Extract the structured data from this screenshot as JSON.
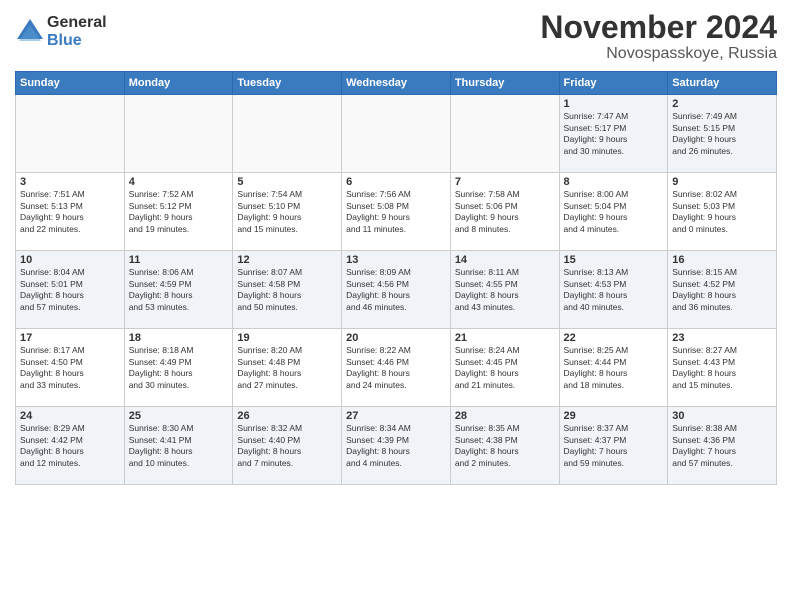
{
  "logo": {
    "general": "General",
    "blue": "Blue"
  },
  "title": "November 2024",
  "location": "Novospasskoye, Russia",
  "days_of_week": [
    "Sunday",
    "Monday",
    "Tuesday",
    "Wednesday",
    "Thursday",
    "Friday",
    "Saturday"
  ],
  "weeks": [
    [
      {
        "day": "",
        "info": ""
      },
      {
        "day": "",
        "info": ""
      },
      {
        "day": "",
        "info": ""
      },
      {
        "day": "",
        "info": ""
      },
      {
        "day": "",
        "info": ""
      },
      {
        "day": "1",
        "info": "Sunrise: 7:47 AM\nSunset: 5:17 PM\nDaylight: 9 hours\nand 30 minutes."
      },
      {
        "day": "2",
        "info": "Sunrise: 7:49 AM\nSunset: 5:15 PM\nDaylight: 9 hours\nand 26 minutes."
      }
    ],
    [
      {
        "day": "3",
        "info": "Sunrise: 7:51 AM\nSunset: 5:13 PM\nDaylight: 9 hours\nand 22 minutes."
      },
      {
        "day": "4",
        "info": "Sunrise: 7:52 AM\nSunset: 5:12 PM\nDaylight: 9 hours\nand 19 minutes."
      },
      {
        "day": "5",
        "info": "Sunrise: 7:54 AM\nSunset: 5:10 PM\nDaylight: 9 hours\nand 15 minutes."
      },
      {
        "day": "6",
        "info": "Sunrise: 7:56 AM\nSunset: 5:08 PM\nDaylight: 9 hours\nand 11 minutes."
      },
      {
        "day": "7",
        "info": "Sunrise: 7:58 AM\nSunset: 5:06 PM\nDaylight: 9 hours\nand 8 minutes."
      },
      {
        "day": "8",
        "info": "Sunrise: 8:00 AM\nSunset: 5:04 PM\nDaylight: 9 hours\nand 4 minutes."
      },
      {
        "day": "9",
        "info": "Sunrise: 8:02 AM\nSunset: 5:03 PM\nDaylight: 9 hours\nand 0 minutes."
      }
    ],
    [
      {
        "day": "10",
        "info": "Sunrise: 8:04 AM\nSunset: 5:01 PM\nDaylight: 8 hours\nand 57 minutes."
      },
      {
        "day": "11",
        "info": "Sunrise: 8:06 AM\nSunset: 4:59 PM\nDaylight: 8 hours\nand 53 minutes."
      },
      {
        "day": "12",
        "info": "Sunrise: 8:07 AM\nSunset: 4:58 PM\nDaylight: 8 hours\nand 50 minutes."
      },
      {
        "day": "13",
        "info": "Sunrise: 8:09 AM\nSunset: 4:56 PM\nDaylight: 8 hours\nand 46 minutes."
      },
      {
        "day": "14",
        "info": "Sunrise: 8:11 AM\nSunset: 4:55 PM\nDaylight: 8 hours\nand 43 minutes."
      },
      {
        "day": "15",
        "info": "Sunrise: 8:13 AM\nSunset: 4:53 PM\nDaylight: 8 hours\nand 40 minutes."
      },
      {
        "day": "16",
        "info": "Sunrise: 8:15 AM\nSunset: 4:52 PM\nDaylight: 8 hours\nand 36 minutes."
      }
    ],
    [
      {
        "day": "17",
        "info": "Sunrise: 8:17 AM\nSunset: 4:50 PM\nDaylight: 8 hours\nand 33 minutes."
      },
      {
        "day": "18",
        "info": "Sunrise: 8:18 AM\nSunset: 4:49 PM\nDaylight: 8 hours\nand 30 minutes."
      },
      {
        "day": "19",
        "info": "Sunrise: 8:20 AM\nSunset: 4:48 PM\nDaylight: 8 hours\nand 27 minutes."
      },
      {
        "day": "20",
        "info": "Sunrise: 8:22 AM\nSunset: 4:46 PM\nDaylight: 8 hours\nand 24 minutes."
      },
      {
        "day": "21",
        "info": "Sunrise: 8:24 AM\nSunset: 4:45 PM\nDaylight: 8 hours\nand 21 minutes."
      },
      {
        "day": "22",
        "info": "Sunrise: 8:25 AM\nSunset: 4:44 PM\nDaylight: 8 hours\nand 18 minutes."
      },
      {
        "day": "23",
        "info": "Sunrise: 8:27 AM\nSunset: 4:43 PM\nDaylight: 8 hours\nand 15 minutes."
      }
    ],
    [
      {
        "day": "24",
        "info": "Sunrise: 8:29 AM\nSunset: 4:42 PM\nDaylight: 8 hours\nand 12 minutes."
      },
      {
        "day": "25",
        "info": "Sunrise: 8:30 AM\nSunset: 4:41 PM\nDaylight: 8 hours\nand 10 minutes."
      },
      {
        "day": "26",
        "info": "Sunrise: 8:32 AM\nSunset: 4:40 PM\nDaylight: 8 hours\nand 7 minutes."
      },
      {
        "day": "27",
        "info": "Sunrise: 8:34 AM\nSunset: 4:39 PM\nDaylight: 8 hours\nand 4 minutes."
      },
      {
        "day": "28",
        "info": "Sunrise: 8:35 AM\nSunset: 4:38 PM\nDaylight: 8 hours\nand 2 minutes."
      },
      {
        "day": "29",
        "info": "Sunrise: 8:37 AM\nSunset: 4:37 PM\nDaylight: 7 hours\nand 59 minutes."
      },
      {
        "day": "30",
        "info": "Sunrise: 8:38 AM\nSunset: 4:36 PM\nDaylight: 7 hours\nand 57 minutes."
      }
    ]
  ]
}
